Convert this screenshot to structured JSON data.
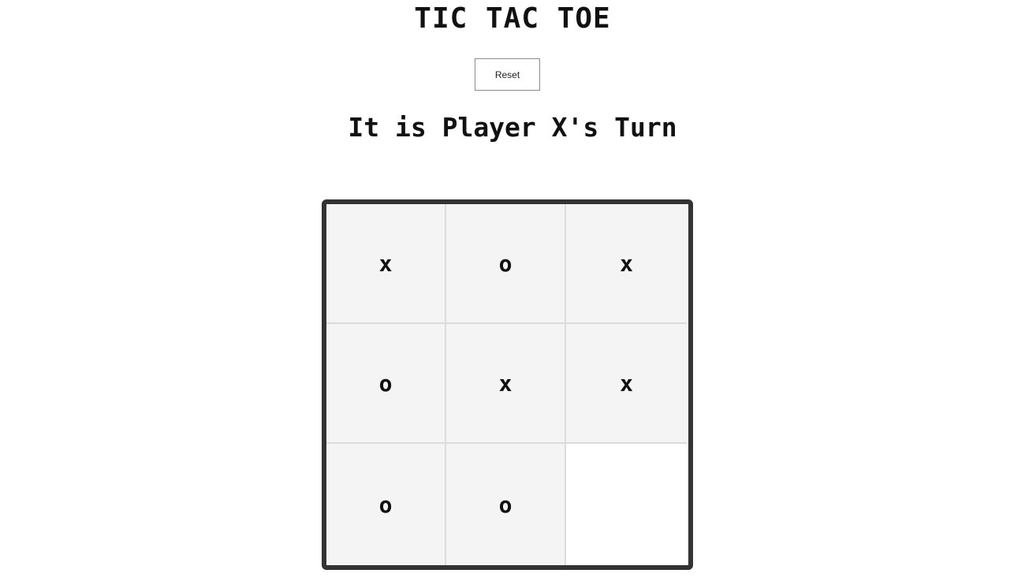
{
  "title": "TIC TAC TOE",
  "reset_label": "Reset",
  "status": "It is Player X's Turn",
  "board": {
    "cells": [
      "x",
      "o",
      "x",
      "o",
      "x",
      "x",
      "o",
      "o",
      ""
    ]
  },
  "colors": {
    "board_border": "#333333",
    "filled_cell": "#f4f4f4",
    "empty_cell": "#ffffff",
    "grid_line": "#dcdcdc"
  }
}
